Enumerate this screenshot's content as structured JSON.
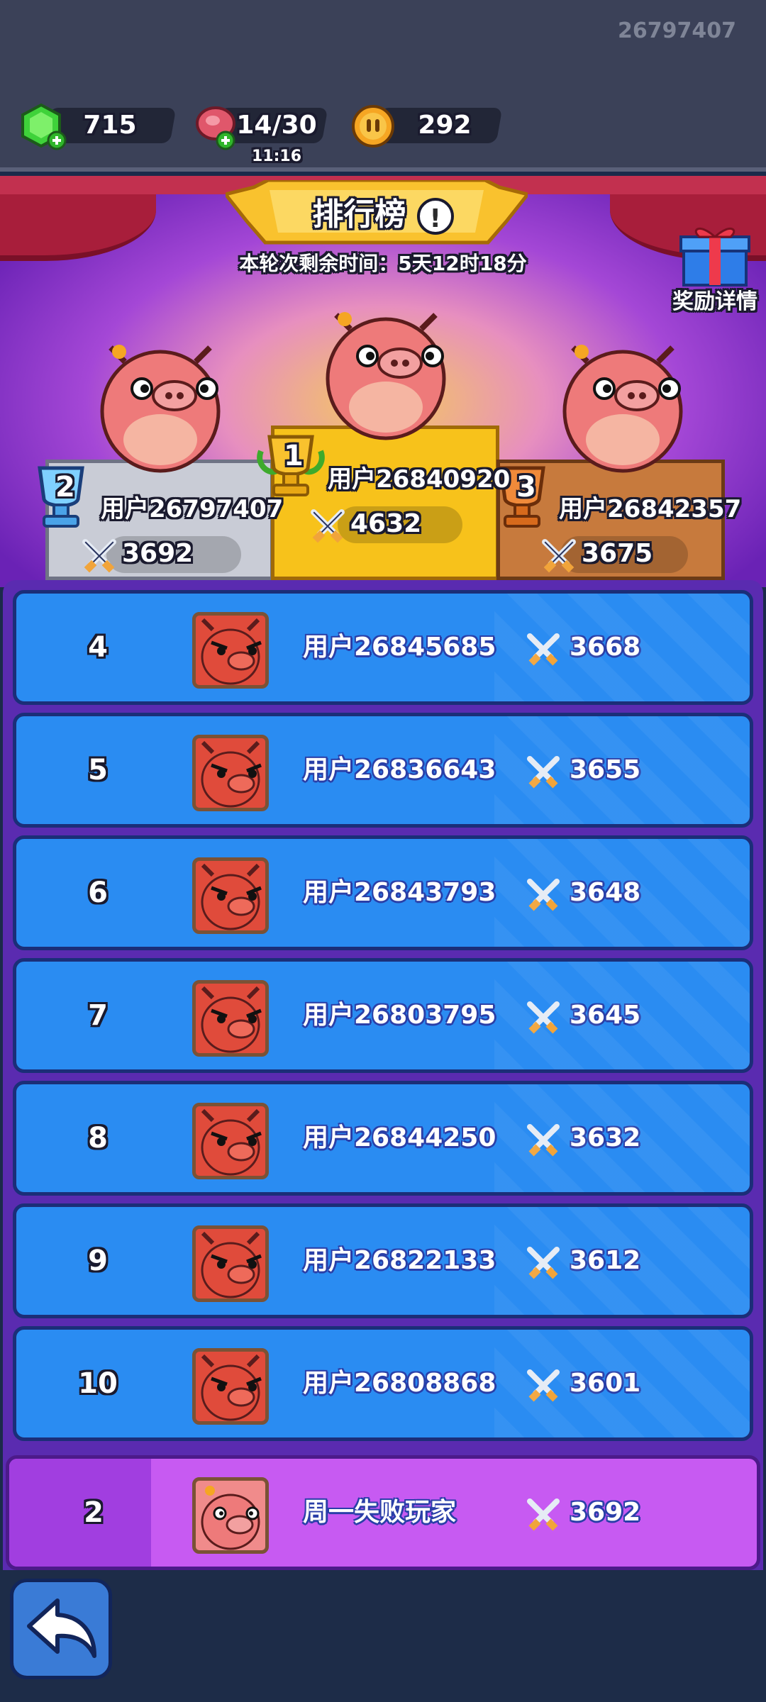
{
  "header": {
    "user_id": "26797407",
    "gems": "715",
    "energy": "14/30",
    "energy_timer": "11:16",
    "coins": "292"
  },
  "leaderboard": {
    "title": "排行榜",
    "countdown": "本轮次剩余时间：5天12时18分",
    "reward_label": "奖励详情"
  },
  "podium": [
    {
      "rank": "1",
      "name": "用户26840920",
      "score": "4632"
    },
    {
      "rank": "2",
      "name": "用户26797407",
      "score": "3692"
    },
    {
      "rank": "3",
      "name": "用户26842357",
      "score": "3675"
    }
  ],
  "rows": [
    {
      "rank": "4",
      "name": "用户26845685",
      "score": "3668"
    },
    {
      "rank": "5",
      "name": "用户26836643",
      "score": "3655"
    },
    {
      "rank": "6",
      "name": "用户26843793",
      "score": "3648"
    },
    {
      "rank": "7",
      "name": "用户26803795",
      "score": "3645"
    },
    {
      "rank": "8",
      "name": "用户26844250",
      "score": "3632"
    },
    {
      "rank": "9",
      "name": "用户26822133",
      "score": "3612"
    },
    {
      "rank": "10",
      "name": "用户26808868",
      "score": "3601"
    }
  ],
  "self": {
    "rank": "2",
    "name": "周一失败玩家",
    "score": "3692"
  },
  "colors": {
    "row_bg": "#2a8cf2",
    "self_row_bg": "#c75af2",
    "gold": "#f7c21b",
    "silver": "#c9ccd6",
    "bronze": "#c77a3d"
  }
}
